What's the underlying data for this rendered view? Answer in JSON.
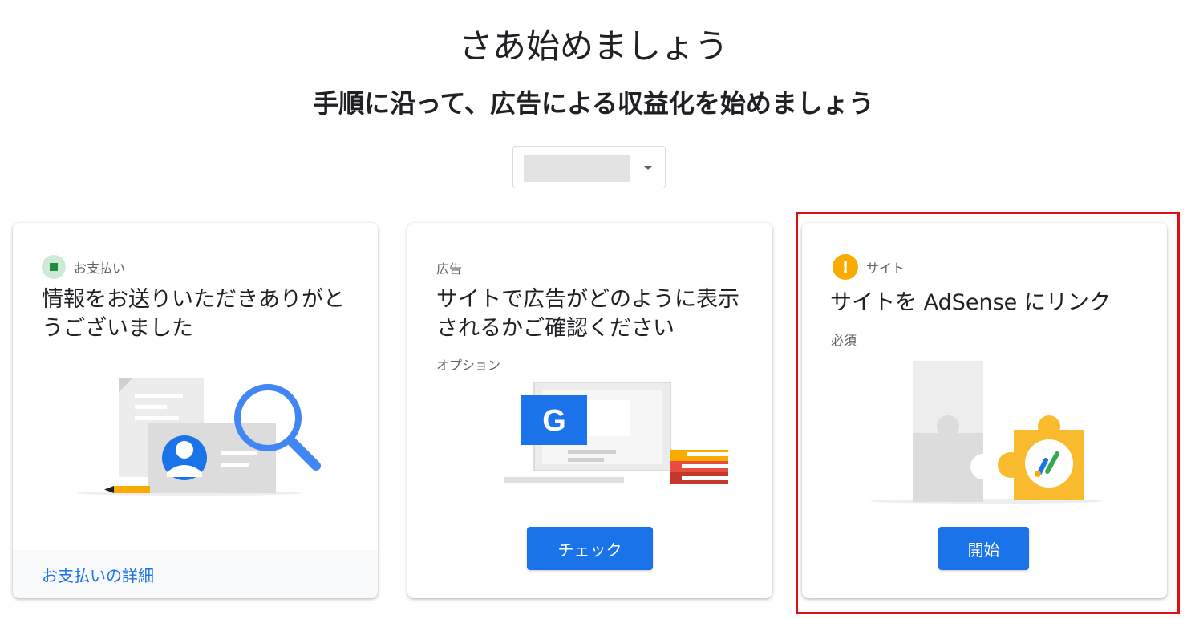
{
  "header": {
    "title": "さあ始めましょう",
    "subtitle": "手順に沿って、広告による収益化を始めましょう"
  },
  "site_select": {
    "icon": "caret-down-icon"
  },
  "cards": [
    {
      "category": "お支払い",
      "category_icon": "payment-status-icon",
      "title_line1": "情報をお送りいただきありがと",
      "title_line2": "うございました",
      "footer_link": "お支払いの詳細"
    },
    {
      "category": "広告",
      "title_line1": "サイトで広告がどのように表示",
      "title_line2": "されるかご確認ください",
      "sub": "オプション",
      "button": "チェック"
    },
    {
      "category": "サイト",
      "category_icon": "warning-icon",
      "warning_glyph": "!",
      "title_line1": "サイトを AdSense にリンク",
      "sub": "必須",
      "button": "開始"
    }
  ],
  "colors": {
    "primary": "#1a73e8",
    "warning": "#f9ab00",
    "success": "#1e8e3e",
    "highlight": "#e01010"
  }
}
